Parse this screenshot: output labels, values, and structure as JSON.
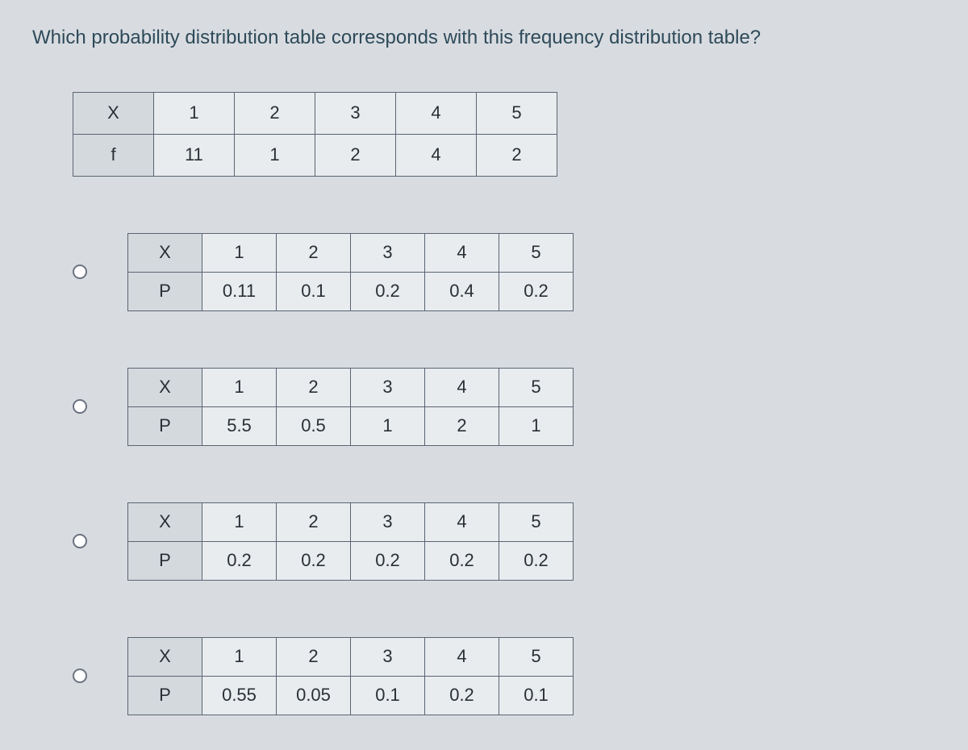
{
  "question": "Which probability distribution table corresponds with this frequency distribution table?",
  "freq": {
    "rowLabels": [
      "X",
      "f"
    ],
    "row1": [
      "1",
      "2",
      "3",
      "4",
      "5"
    ],
    "row2": [
      "11",
      "1",
      "2",
      "4",
      "2"
    ]
  },
  "options": [
    {
      "rowLabels": [
        "X",
        "P"
      ],
      "r1": [
        "1",
        "2",
        "3",
        "4",
        "5"
      ],
      "r2": [
        "0.11",
        "0.1",
        "0.2",
        "0.4",
        "0.2"
      ]
    },
    {
      "rowLabels": [
        "X",
        "P"
      ],
      "r1": [
        "1",
        "2",
        "3",
        "4",
        "5"
      ],
      "r2": [
        "5.5",
        "0.5",
        "1",
        "2",
        "1"
      ]
    },
    {
      "rowLabels": [
        "X",
        "P"
      ],
      "r1": [
        "1",
        "2",
        "3",
        "4",
        "5"
      ],
      "r2": [
        "0.2",
        "0.2",
        "0.2",
        "0.2",
        "0.2"
      ]
    },
    {
      "rowLabels": [
        "X",
        "P"
      ],
      "r1": [
        "1",
        "2",
        "3",
        "4",
        "5"
      ],
      "r2": [
        "0.55",
        "0.05",
        "0.1",
        "0.2",
        "0.1"
      ]
    }
  ],
  "chart_data": [
    {
      "type": "table",
      "title": "Frequency distribution",
      "rows": [
        {
          "label": "X",
          "values": [
            1,
            2,
            3,
            4,
            5
          ]
        },
        {
          "label": "f",
          "values": [
            11,
            1,
            2,
            4,
            2
          ]
        }
      ]
    },
    {
      "type": "table",
      "title": "Option A",
      "rows": [
        {
          "label": "X",
          "values": [
            1,
            2,
            3,
            4,
            5
          ]
        },
        {
          "label": "P",
          "values": [
            0.11,
            0.1,
            0.2,
            0.4,
            0.2
          ]
        }
      ]
    },
    {
      "type": "table",
      "title": "Option B",
      "rows": [
        {
          "label": "X",
          "values": [
            1,
            2,
            3,
            4,
            5
          ]
        },
        {
          "label": "P",
          "values": [
            5.5,
            0.5,
            1,
            2,
            1
          ]
        }
      ]
    },
    {
      "type": "table",
      "title": "Option C",
      "rows": [
        {
          "label": "X",
          "values": [
            1,
            2,
            3,
            4,
            5
          ]
        },
        {
          "label": "P",
          "values": [
            0.2,
            0.2,
            0.2,
            0.2,
            0.2
          ]
        }
      ]
    },
    {
      "type": "table",
      "title": "Option D",
      "rows": [
        {
          "label": "X",
          "values": [
            1,
            2,
            3,
            4,
            5
          ]
        },
        {
          "label": "P",
          "values": [
            0.55,
            0.05,
            0.1,
            0.2,
            0.1
          ]
        }
      ]
    }
  ]
}
